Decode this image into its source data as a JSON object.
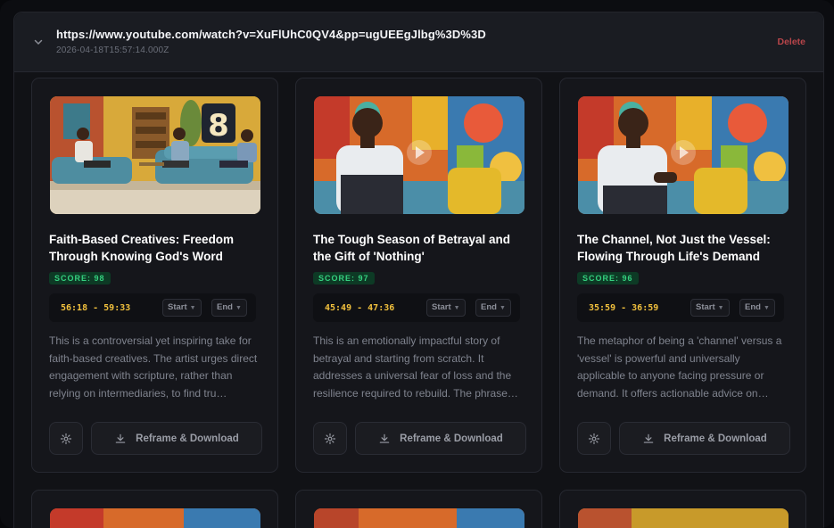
{
  "header": {
    "url": "https://www.youtube.com/watch?v=XuFlUhC0QV4&pp=ugUEEgJlbg%3D%3D",
    "timestamp": "2026-04-18T15:57:14.000Z",
    "delete_label": "Delete",
    "toggle_icon": "chevron-down-icon"
  },
  "clips": [
    {
      "title": "Faith-Based Creatives: Freedom Through Knowing God's Word",
      "score": "SCORE: 98",
      "time_range": "56:18 - 59:33",
      "start_label": "Start",
      "end_label": "End",
      "description": "This is a controversial yet inspiring take for faith-based creatives. The artist urges direct engagement with scripture, rather than relying on intermediaries, to find tru…",
      "action_label": "Reframe & Download"
    },
    {
      "title": "The Tough Season of Betrayal and the Gift of 'Nothing'",
      "score": "SCORE: 97",
      "time_range": "45:49 - 47:36",
      "start_label": "Start",
      "end_label": "End",
      "description": "This is an emotionally impactful story of betrayal and starting from scratch. It addresses a universal fear of loss and the resilience required to rebuild. The phrase…",
      "action_label": "Reframe & Download"
    },
    {
      "title": "The Channel, Not Just the Vessel: Flowing Through Life's Demand",
      "score": "SCORE: 96",
      "time_range": "35:59 - 36:59",
      "start_label": "Start",
      "end_label": "End",
      "description": "The metaphor of being a 'channel' versus a 'vessel' is powerful and universally applicable to anyone facing pressure or demand. It offers actionable advice on…",
      "action_label": "Reframe & Download"
    }
  ],
  "colors": {
    "score_text": "#35d07f",
    "score_bg": "#0d3a25",
    "time_text": "#f2c13d",
    "delete_text": "#b8454a"
  }
}
